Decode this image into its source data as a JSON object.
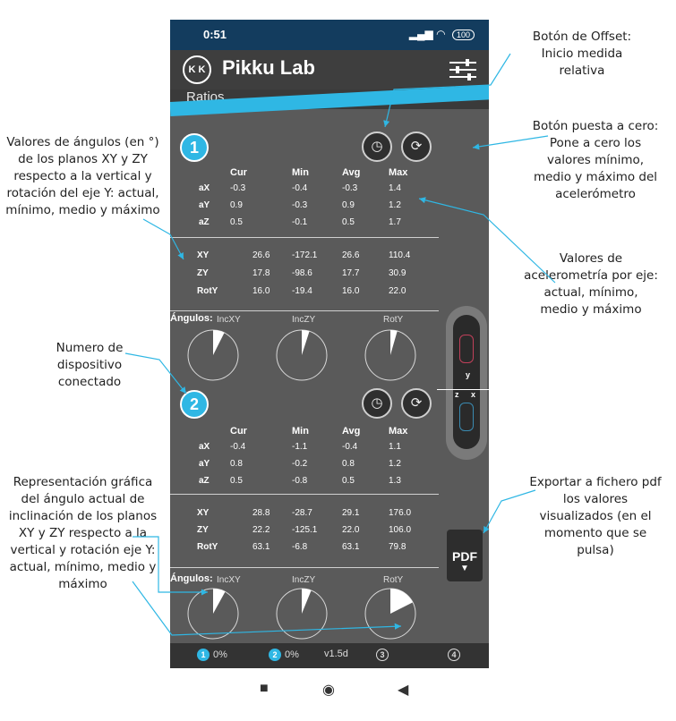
{
  "status": {
    "time": "0:51",
    "battery": "100"
  },
  "app": {
    "title": "Pikku Lab",
    "logo": "K K",
    "section": "Ratios"
  },
  "devices": [
    {
      "number": "1",
      "headers": [
        "Cur",
        "Min",
        "Avg",
        "Max"
      ],
      "accel": [
        {
          "label": "aX",
          "cur": "-0.3",
          "min": "-0.4",
          "avg": "-0.3",
          "max": "1.4"
        },
        {
          "label": "aY",
          "cur": "0.9",
          "min": "-0.3",
          "avg": "0.9",
          "max": "1.2"
        },
        {
          "label": "aZ",
          "cur": "0.5",
          "min": "-0.1",
          "avg": "0.5",
          "max": "1.7"
        }
      ],
      "angles": [
        {
          "label": "XY",
          "cur": "26.6",
          "min": "-172.1",
          "avg": "26.6",
          "max": "110.4"
        },
        {
          "label": "ZY",
          "cur": "17.8",
          "min": "-98.6",
          "avg": "17.7",
          "max": "30.9"
        },
        {
          "label": "RotY",
          "cur": "16.0",
          "min": "-19.4",
          "avg": "16.0",
          "max": "22.0"
        }
      ],
      "angulos_label": "Ángulos:",
      "pie_labels": [
        "IncXY",
        "IncZY",
        "RotY"
      ],
      "pie_deg": [
        26.6,
        17.8,
        16.0
      ]
    },
    {
      "number": "2",
      "headers": [
        "Cur",
        "Min",
        "Avg",
        "Max"
      ],
      "accel": [
        {
          "label": "aX",
          "cur": "-0.4",
          "min": "-1.1",
          "avg": "-0.4",
          "max": "1.1"
        },
        {
          "label": "aY",
          "cur": "0.8",
          "min": "-0.2",
          "avg": "0.8",
          "max": "1.2"
        },
        {
          "label": "aZ",
          "cur": "0.5",
          "min": "-0.8",
          "avg": "0.5",
          "max": "1.3"
        }
      ],
      "angles": [
        {
          "label": "XY",
          "cur": "28.8",
          "min": "-28.7",
          "avg": "29.1",
          "max": "176.0"
        },
        {
          "label": "ZY",
          "cur": "22.2",
          "min": "-125.1",
          "avg": "22.0",
          "max": "106.0"
        },
        {
          "label": "RotY",
          "cur": "63.1",
          "min": "-6.8",
          "avg": "63.1",
          "max": "79.8"
        }
      ],
      "angulos_label": "Ángulos:",
      "pie_labels": [
        "IncXY",
        "IncZY",
        "RotY"
      ],
      "pie_deg": [
        28.8,
        22.2,
        63.1
      ]
    }
  ],
  "device_axes": {
    "y": "y",
    "z": "z",
    "x": "x"
  },
  "pdf_label": "PDF",
  "bottom": {
    "d1": "1",
    "d1_pct": "0%",
    "d2": "2",
    "d2_pct": "0%",
    "version": "v1.5d",
    "d3": "3",
    "d4": "4"
  },
  "annotations": {
    "offset": "Botón de Offset: Inicio medida relativa",
    "reset": "Botón puesta a cero: Pone a cero los valores mínimo, medio y máximo del acelerómetro",
    "angles_values": "Valores de ángulos (en °) de los planos XY y ZY respecto a la vertical y rotación del eje Y: actual, mínimo, medio y máximo",
    "accel_values": "Valores de acelerometría por eje: actual, mínimo, medio y máximo",
    "device_number": "Numero de dispositivo conectado",
    "export": "Exportar a fichero pdf los valores visualizados (en el momento que se pulsa)",
    "graph": "Representación gráfica del ángulo actual de inclinación de los planos XY y ZY respecto a la vertical y rotación eje Y: actual, mínimo, medio y máximo"
  },
  "colors": {
    "accent": "#2fb7e4",
    "bg": "#5a5a5a",
    "status": "#133c5e"
  }
}
